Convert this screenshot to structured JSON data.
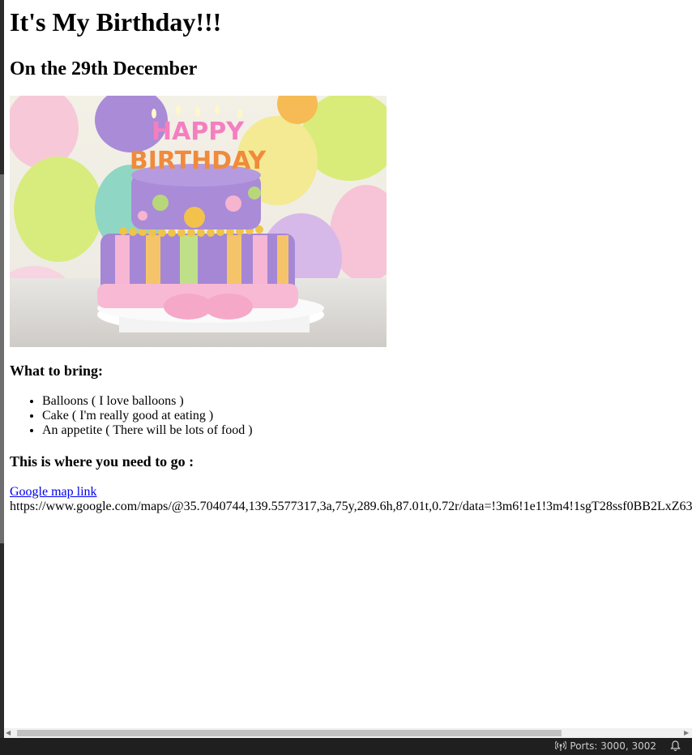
{
  "page": {
    "title": "It's My Birthday!!!",
    "subtitle": "On the 29th December",
    "hero_image": {
      "icon": "birthday-cake-image",
      "cake_text_top": "HAPPY",
      "cake_text_bottom": "BIRTHDAY"
    },
    "bring_heading": "What to bring:",
    "bring_items": [
      "Balloons ( I love balloons )",
      "Cake ( I'm really good at eating )",
      "An appetite ( There will be lots of food )"
    ],
    "map_heading": "This is where you need to go :",
    "map_link_text": "Google map link",
    "map_url": "https://www.google.com/maps/@35.7040744,139.5577317,3a,75y,289.6h,87.01t,0.72r/data=!3m6!1e1!3m4!1sgT28ssf0BB2LxZ63"
  },
  "statusbar": {
    "ports": "Ports: 3000, 3002",
    "ports_icon": "broadcast-icon",
    "bell_icon": "bell-icon"
  },
  "colors": {
    "link": "#0000ee",
    "statusbar_bg": "#1f1f1f"
  }
}
